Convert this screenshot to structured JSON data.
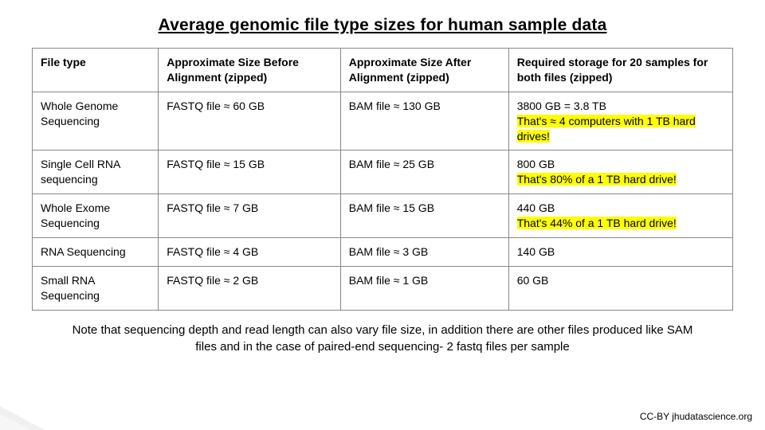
{
  "title": "Average genomic  file type sizes for human sample  data",
  "headers": {
    "c1": "File type",
    "c2": "Approximate Size Before Alignment (zipped)",
    "c3": "Approximate Size After Alignment (zipped)",
    "c4": "Required storage for 20 samples for both files (zipped)"
  },
  "rows": [
    {
      "file_type": "Whole Genome Sequencing",
      "before": "FASTQ file ≈ 60 GB",
      "after": "BAM file ≈ 130 GB",
      "storage": "3800 GB = 3.8 TB",
      "storage_hl": "That's ≈ 4 computers with 1 TB hard drives!"
    },
    {
      "file_type": "Single Cell RNA sequencing",
      "before": "FASTQ file ≈ 15 GB",
      "after": "BAM file ≈ 25 GB",
      "storage": "800 GB",
      "storage_hl": "That's 80% of a 1 TB hard drive!"
    },
    {
      "file_type": "Whole Exome Sequencing",
      "before": "FASTQ file ≈ 7 GB",
      "after": "BAM file ≈ 15 GB",
      "storage": "440 GB",
      "storage_hl": "That's  44% of a 1 TB hard drive!"
    },
    {
      "file_type": "RNA Sequencing",
      "before": "FASTQ file ≈ 4 GB",
      "after": "BAM file ≈ 3 GB",
      "storage": "140 GB",
      "storage_hl": ""
    },
    {
      "file_type": "Small RNA Sequencing",
      "before": "FASTQ file ≈ 2 GB",
      "after": "BAM file ≈ 1 GB",
      "storage": "60 GB",
      "storage_hl": ""
    }
  ],
  "note": "Note that sequencing depth and read length can also vary file size, in addition there are other files produced like SAM files and in the case of paired-end sequencing- 2 fastq files per sample",
  "credit": "CC-BY jhudatascience.org",
  "chart_data": {
    "type": "table",
    "title": "Average genomic file type sizes for human sample data",
    "columns": [
      "File type",
      "Approximate Size Before Alignment (zipped)",
      "Approximate Size After Alignment (zipped)",
      "Required storage for 20 samples for both files (zipped)"
    ],
    "rows": [
      [
        "Whole Genome Sequencing",
        "FASTQ file ≈ 60 GB",
        "BAM file ≈ 130 GB",
        "3800 GB = 3.8 TB — ≈ 4 computers with 1 TB hard drives"
      ],
      [
        "Single Cell RNA sequencing",
        "FASTQ file ≈ 15 GB",
        "BAM file ≈ 25 GB",
        "800 GB — 80% of a 1 TB hard drive"
      ],
      [
        "Whole Exome Sequencing",
        "FASTQ file ≈ 7 GB",
        "BAM file ≈ 15 GB",
        "440 GB — 44% of a 1 TB hard drive"
      ],
      [
        "RNA Sequencing",
        "FASTQ file ≈ 4 GB",
        "BAM file ≈ 3 GB",
        "140 GB"
      ],
      [
        "Small RNA Sequencing",
        "FASTQ file ≈ 2 GB",
        "BAM file ≈ 1 GB",
        "60 GB"
      ]
    ]
  }
}
